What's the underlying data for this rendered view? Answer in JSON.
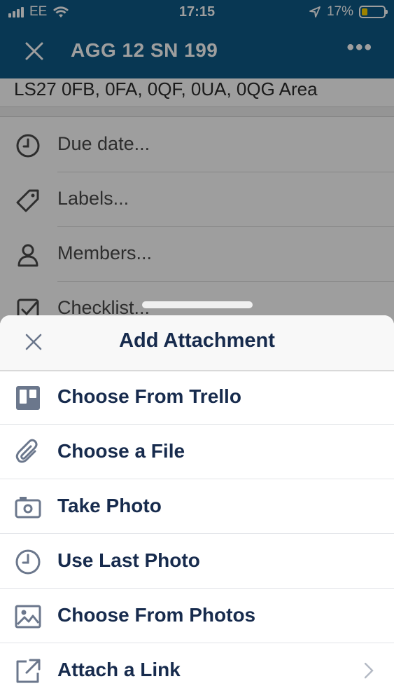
{
  "status_bar": {
    "carrier": "EE",
    "time": "17:15",
    "battery": "17%"
  },
  "nav": {
    "title": "AGG 12 SN 199",
    "more": "•••"
  },
  "card": {
    "address": "LS27 0FB, 0FA, 0QF, 0UA, 0QG Area",
    "rows": [
      {
        "label": "Due date...",
        "icon": "clock-icon"
      },
      {
        "label": "Labels...",
        "icon": "tag-icon"
      },
      {
        "label": "Members...",
        "icon": "person-icon"
      },
      {
        "label": "Checklist...",
        "icon": "checkbox-icon"
      }
    ]
  },
  "sheet": {
    "title": "Add Attachment",
    "items": [
      {
        "label": "Choose From Trello",
        "icon": "trello-icon"
      },
      {
        "label": "Choose a File",
        "icon": "paperclip-icon"
      },
      {
        "label": "Take Photo",
        "icon": "camera-icon"
      },
      {
        "label": "Use Last Photo",
        "icon": "clock-icon"
      },
      {
        "label": "Choose From Photos",
        "icon": "image-icon"
      },
      {
        "label": "Attach a Link",
        "icon": "external-link-icon"
      }
    ]
  },
  "colors": {
    "brand": "#0d5a86",
    "text_dark": "#172b4d",
    "icon_gray": "#6b778c"
  }
}
